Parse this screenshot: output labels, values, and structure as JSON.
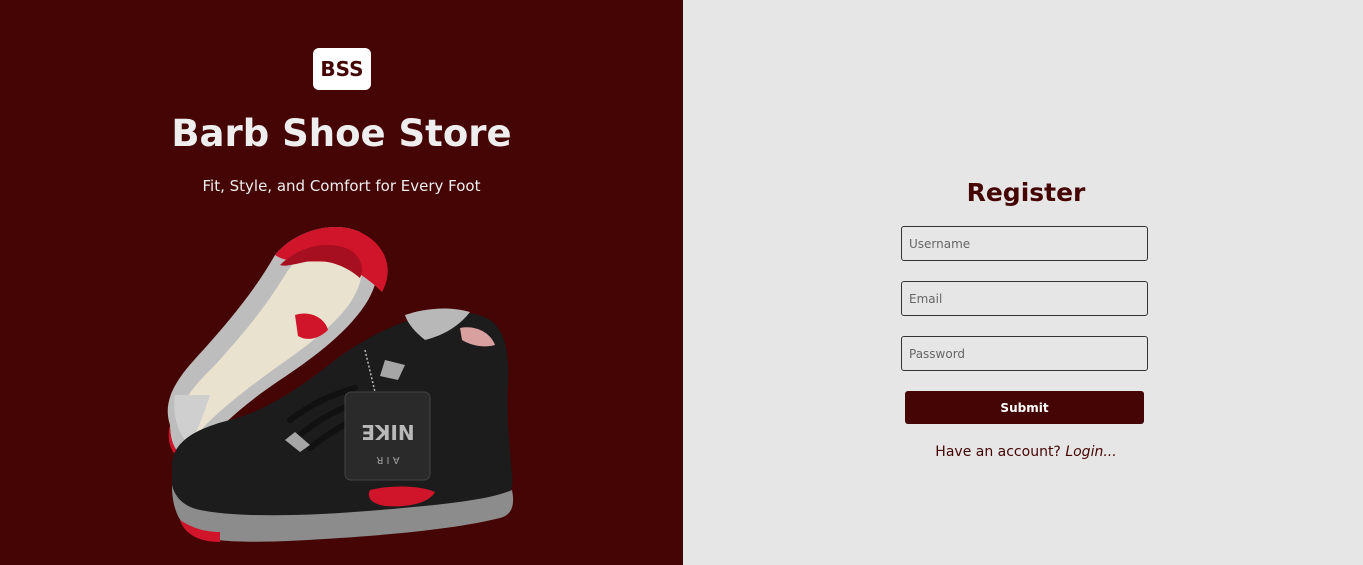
{
  "brand": {
    "logo_text": "BSS",
    "title": "Barb Shoe Store",
    "tagline": "Fit, Style, and Comfort for Every Foot",
    "image_alt": "NIKE AIR"
  },
  "form": {
    "title": "Register",
    "username_placeholder": "Username",
    "email_placeholder": "Email",
    "password_placeholder": "Password",
    "submit_label": "Submit",
    "account_prompt": "Have an account?",
    "login_label": "Login..."
  },
  "colors": {
    "brand_dark_red": "#450505",
    "panel_gray": "#e6e6e6",
    "sole_red": "#d0142a"
  }
}
